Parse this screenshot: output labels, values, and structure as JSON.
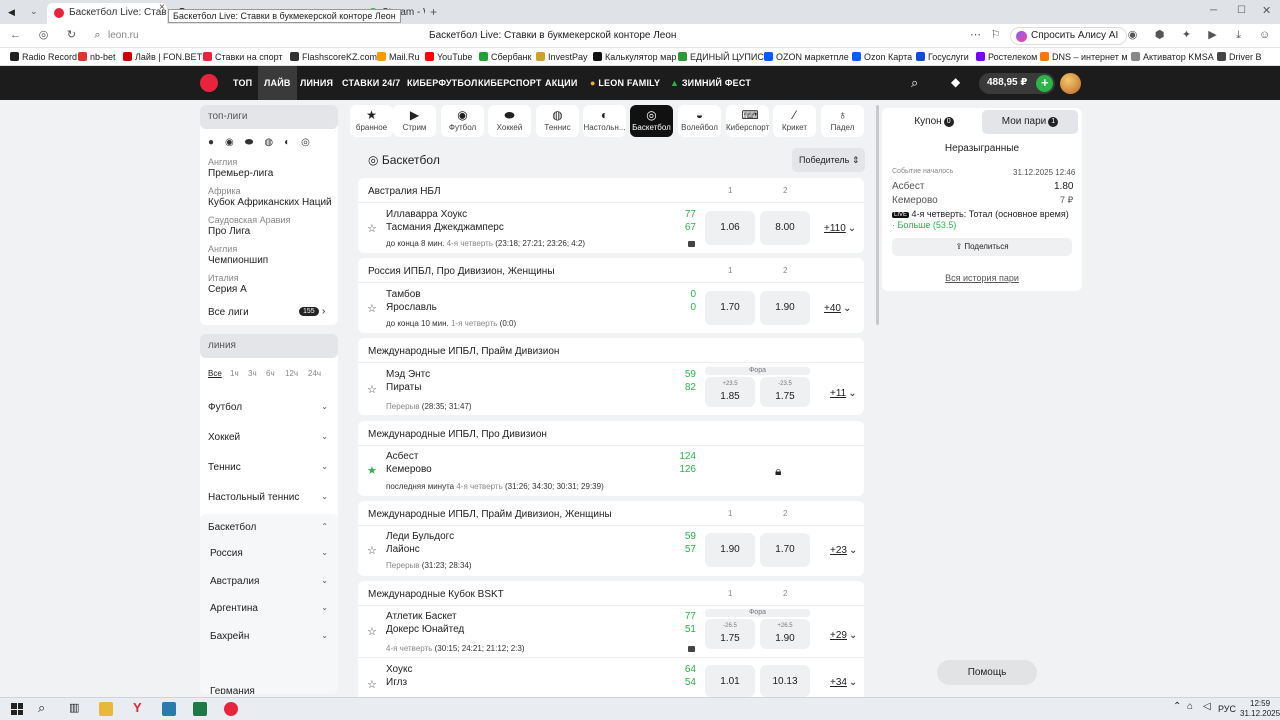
{
  "browser": {
    "tabs": [
      {
        "label": "Баскетбол Live: Ставки"
      },
      {
        "label": "Stream - Wa"
      },
      {
        "label": ""
      }
    ],
    "tooltip": "Баскетбол Live: Ставки в букмекерской конторе Леон",
    "url": "leon.ru",
    "page_title": "Баскетбол Live: Ставки в букмекерской конторе Леон",
    "alisa_label": "Спросить Алису AI",
    "bookmarks": [
      "Radio Record",
      "nb-bet",
      "Лайв | FON.BET",
      "Ставки на спорт",
      "FlashscoreKZ.com",
      "Mail.Ru",
      "YouTube",
      "Сбербанк",
      "InvestPay",
      "Калькулятор мар",
      "ЕДИНЫЙ ЦУПИС",
      "OZON маркетпле",
      "Ozon Карта",
      "Госуслуги",
      "Ростелеком",
      "DNS – интернет м",
      "Активатор KMSA",
      "Driver B"
    ]
  },
  "site_nav": {
    "items": [
      "ТОП",
      "ЛАЙВ",
      "ЛИНИЯ",
      "СТАВКИ 24/7",
      "КИБЕРФУТБОЛ",
      "КИБЕРСПОРТ",
      "АКЦИИ",
      "LEON FAMILY",
      "ЗИМНИЙ ФЕСТ"
    ],
    "balance": "488,95 ₽"
  },
  "sidebar": {
    "top_leagues_title": "топ-лиги",
    "leagues": [
      {
        "country": "Англия",
        "name": "Премьер-лига"
      },
      {
        "country": "Африка",
        "name": "Кубок Африканских Наций"
      },
      {
        "country": "Саудовская Аравия",
        "name": "Про Лига"
      },
      {
        "country": "Англия",
        "name": "Чемпионшип"
      },
      {
        "country": "Италия",
        "name": "Серия А"
      }
    ],
    "all_leagues_label": "Все лиги",
    "all_leagues_count": "155",
    "line_title": "линия",
    "time_filters": [
      "Все",
      "1ч",
      "3ч",
      "6ч",
      "12ч",
      "24ч"
    ],
    "categories": [
      "Футбол",
      "Хоккей",
      "Теннис",
      "Настольный теннис",
      "Баскетбол"
    ],
    "basketball_sub": [
      "Россия",
      "Австралия",
      "Аргентина",
      "Бахрейн",
      "Германия"
    ]
  },
  "sports_bar": [
    "бранное",
    "Стрим",
    "Футбол",
    "Хоккей",
    "Теннис",
    "Настольн...",
    "Баскетбол",
    "Волейбол",
    "Киберспорт",
    "Крикет",
    "Падел"
  ],
  "main": {
    "title": "Баскетбол",
    "sort_label": "Победитель",
    "col1": "1",
    "col2": "2",
    "fora_label": "Фора",
    "blocks": [
      {
        "league": "Австралия НБЛ",
        "matches": [
          {
            "team1": "Иллаварра Хоукс",
            "team2": "Тасмания Джекджамперс",
            "score1": "77",
            "score2": "67",
            "time": "до конца 8 мин.",
            "period": "4-я четверть",
            "detail": "(23:18; 27:21; 23:26; 4:2)",
            "odd1": "1.06",
            "odd2": "8.00",
            "more": "+110"
          }
        ]
      },
      {
        "league": "Россия ИПБЛ, Про Дивизион, Женщины",
        "matches": [
          {
            "team1": "Тамбов",
            "team2": "Ярославль",
            "score1": "0",
            "score2": "0",
            "time": "до конца 10 мин.",
            "period": "1-я четверть",
            "detail": "(0:0)",
            "odd1": "1.70",
            "odd2": "1.90",
            "more": "+40"
          }
        ]
      },
      {
        "league": "Международные ИПБЛ, Прайм Дивизион",
        "matches": [
          {
            "team1": "Мэд Энтс",
            "team2": "Пираты",
            "score1": "59",
            "score2": "82",
            "time": "",
            "period": "Перерыв",
            "detail": "(28:35; 31:47)",
            "h1": "+23.5",
            "odd1": "1.85",
            "h2": "-23.5",
            "odd2": "1.75",
            "more": "+11"
          }
        ]
      },
      {
        "league": "Международные ИПБЛ, Про Дивизион",
        "matches": [
          {
            "team1": "Асбест",
            "team2": "Кемерово",
            "score1": "124",
            "score2": "126",
            "time": "последняя минута",
            "period": "4-я четверть",
            "detail": "(31:26; 34:30; 30:31; 29:39)"
          }
        ]
      },
      {
        "league": "Международные ИПБЛ, Прайм Дивизион, Женщины",
        "matches": [
          {
            "team1": "Леди Бульдогс",
            "team2": "Лайонс",
            "score1": "59",
            "score2": "57",
            "time": "",
            "period": "Перерыв",
            "detail": "(31:23; 28:34)",
            "odd1": "1.90",
            "odd2": "1.70",
            "more": "+23"
          }
        ]
      },
      {
        "league": "Международные Кубок BSKT",
        "matches": [
          {
            "team1": "Атлетик Баскет",
            "team2": "Докерс Юнайтед",
            "score1": "77",
            "score2": "51",
            "time": "",
            "period": "4-я четверть",
            "detail": "(30:15; 24:21; 21:12; 2:3)",
            "h1": "-26.5",
            "odd1": "1.75",
            "h2": "+26.5",
            "odd2": "1.90",
            "more": "+29"
          },
          {
            "team1": "Хоукс",
            "team2": "Иглз",
            "score1": "64",
            "score2": "54",
            "odd1": "1.01",
            "odd2": "10.13",
            "more": "+34"
          }
        ]
      }
    ]
  },
  "coupon": {
    "tab_coupon": "Купон",
    "coupon_count": "0",
    "tab_bets": "Мои пари",
    "bets_count": "1",
    "section": "Неразыгранные",
    "started_label": "Событие началось",
    "date": "31.12.2025 12:46",
    "team1": "Асбест",
    "team1_odd": "1.80",
    "team2": "Кемерово",
    "stake": "7 ₽",
    "live_tag": "LIVE",
    "market": "4-я четверть: Тотал (основное время)",
    "selection": "· Больше (53.5)",
    "share_label": "Поделиться",
    "history_link": "Вся история пари"
  },
  "help_label": "Помощь",
  "taskbar": {
    "lang": "РУС",
    "time": "12:59",
    "date": "31.12.2025"
  }
}
